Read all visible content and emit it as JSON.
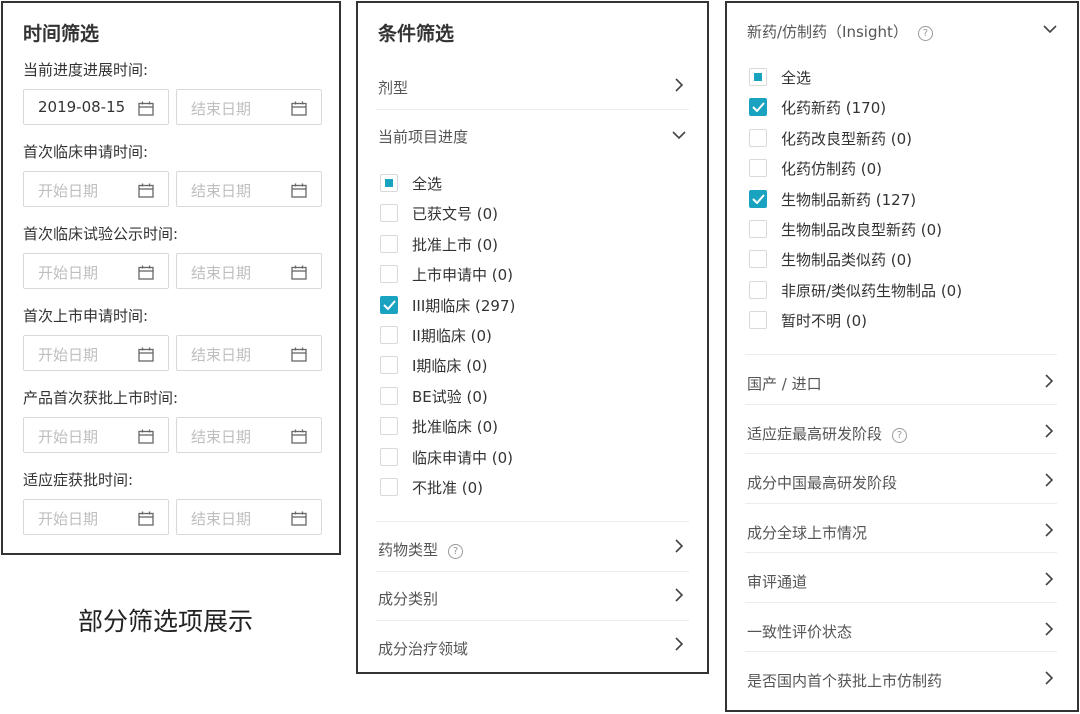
{
  "time_panel": {
    "title": "时间筛选",
    "groups": [
      {
        "label": "当前进度进展时间:",
        "start": "2019-08-15",
        "end": "结束日期"
      },
      {
        "label": "首次临床申请时间:",
        "start": "开始日期",
        "end": "结束日期"
      },
      {
        "label": "首次临床试验公示时间:",
        "start": "开始日期",
        "end": "结束日期"
      },
      {
        "label": "首次上市申请时间:",
        "start": "开始日期",
        "end": "结束日期"
      },
      {
        "label": "产品首次获批上市时间:",
        "start": "开始日期",
        "end": "结束日期"
      },
      {
        "label": "适应症获批时间:",
        "start": "开始日期",
        "end": "结束日期"
      }
    ]
  },
  "condition_panel": {
    "title": "条件筛选",
    "dosage": "剂型",
    "progress": {
      "label": "当前项目进度",
      "options": [
        {
          "label": "全选",
          "state": "partial"
        },
        {
          "label": "已获文号 (0)",
          "state": "unchecked"
        },
        {
          "label": "批准上市 (0)",
          "state": "unchecked"
        },
        {
          "label": "上市申请中 (0)",
          "state": "unchecked"
        },
        {
          "label": "III期临床 (297)",
          "state": "checked"
        },
        {
          "label": "II期临床 (0)",
          "state": "unchecked"
        },
        {
          "label": "I期临床 (0)",
          "state": "unchecked"
        },
        {
          "label": "BE试验 (0)",
          "state": "unchecked"
        },
        {
          "label": "批准临床 (0)",
          "state": "unchecked"
        },
        {
          "label": "临床申请中 (0)",
          "state": "unchecked"
        },
        {
          "label": "不批准 (0)",
          "state": "unchecked"
        }
      ]
    },
    "drug_type": "药物类型",
    "ingredient_category": "成分类别",
    "ingredient_therapy": "成分治疗领域"
  },
  "new_drug_panel": {
    "header": "新药/仿制药（Insight）",
    "options": [
      {
        "label": "全选",
        "state": "partial"
      },
      {
        "label": "化药新药 (170)",
        "state": "checked"
      },
      {
        "label": "化药改良型新药 (0)",
        "state": "unchecked"
      },
      {
        "label": "化药仿制药 (0)",
        "state": "unchecked"
      },
      {
        "label": "生物制品新药 (127)",
        "state": "checked"
      },
      {
        "label": "生物制品改良型新药 (0)",
        "state": "unchecked"
      },
      {
        "label": "生物制品类似药 (0)",
        "state": "unchecked"
      },
      {
        "label": "非原研/类似药生物制品 (0)",
        "state": "unchecked"
      },
      {
        "label": "暂时不明 (0)",
        "state": "unchecked"
      }
    ],
    "sections": [
      {
        "label": "国产 / 进口",
        "help": false
      },
      {
        "label": "适应症最高研发阶段",
        "help": true
      },
      {
        "label": "成分中国最高研发阶段",
        "help": false
      },
      {
        "label": "成分全球上市情况",
        "help": false
      },
      {
        "label": "审评通道",
        "help": false
      },
      {
        "label": "一致性评价状态",
        "help": false
      },
      {
        "label": "是否国内首个获批上市仿制药",
        "help": false
      }
    ]
  },
  "caption": "部分筛选项展示",
  "colors": {
    "accent": "#19a3c1",
    "border": "#333333",
    "placeholder": "#bfbfbf"
  }
}
